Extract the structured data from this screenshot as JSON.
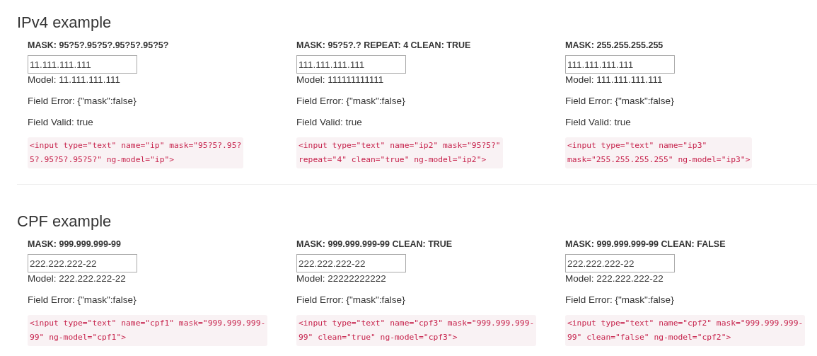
{
  "sections": [
    {
      "title": "IPv4 example",
      "examples": [
        {
          "mask_label": "MASK: 95?5?.95?5?.95?5?.95?5?",
          "value": "11.111.111.111",
          "model": "Model: 11.111.111.111",
          "error": "Field Error: {\"mask\":false}",
          "valid": "Field Valid: true",
          "code": "<input type=\"text\" name=\"ip\" mask=\"95?5?.95?\n5?.95?5?.95?5?\" ng-model=\"ip\">"
        },
        {
          "mask_label": "MASK: 95?5?.? REPEAT: 4 CLEAN: TRUE",
          "value": "111.111.111.111",
          "model": "Model: 111111111111",
          "error": "Field Error: {\"mask\":false}",
          "valid": "Field Valid: true",
          "code": "<input type=\"text\" name=\"ip2\" mask=\"95?5?\"\nrepeat=\"4\" clean=\"true\" ng-model=\"ip2\">"
        },
        {
          "mask_label": "MASK: 255.255.255.255",
          "value": "111.111.111.111",
          "model": "Model: 111.111.111.111",
          "error": "Field Error: {\"mask\":false}",
          "valid": "Field Valid: true",
          "code": "<input type=\"text\" name=\"ip3\"\nmask=\"255.255.255.255\" ng-model=\"ip3\">"
        }
      ]
    },
    {
      "title": "CPF example",
      "examples": [
        {
          "mask_label": "MASK: 999.999.999-99",
          "value": "222.222.222-22",
          "model": "Model: 222.222.222-22",
          "error": "Field Error: {\"mask\":false}",
          "code": "<input type=\"text\" name=\"cpf1\" mask=\"999.999.999-\n99\" ng-model=\"cpf1\">"
        },
        {
          "mask_label": "MASK: 999.999.999-99 CLEAN: TRUE",
          "value": "222.222.222-22",
          "model": "Model: 22222222222",
          "error": "Field Error: {\"mask\":false}",
          "code": "<input type=\"text\" name=\"cpf3\" mask=\"999.999.999-\n99\" clean=\"true\" ng-model=\"cpf3\">"
        },
        {
          "mask_label": "MASK: 999.999.999-99 CLEAN: FALSE",
          "value": "222.222.222-22",
          "model": "Model: 222.222.222-22",
          "error": "Field Error: {\"mask\":false}",
          "code": "<input type=\"text\" name=\"cpf2\" mask=\"999.999.999-\n99\" clean=\"false\" ng-model=\"cpf2\">"
        }
      ]
    }
  ]
}
